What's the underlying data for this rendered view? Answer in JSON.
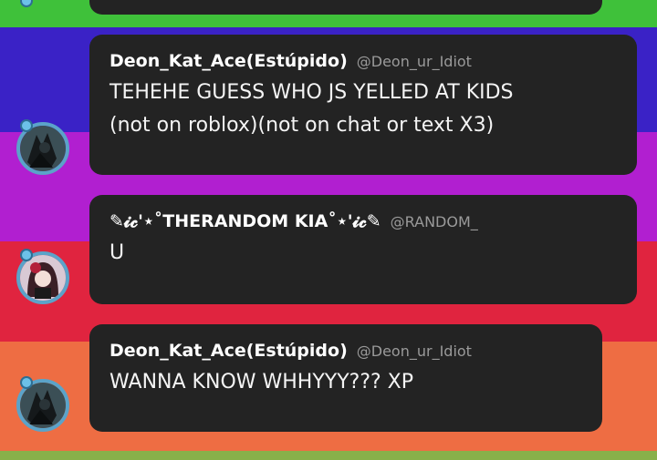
{
  "messages": [
    {
      "author": "Deon_Kat_Ace(Estúpido)",
      "handle": "@Deon_ur_Idiot",
      "lines": [
        "TEHEHE GUESS WHO JS YELLED AT KIDS",
        "(not on roblox)(not on chat or text X3)"
      ],
      "avatar_icon": "dark-character-avatar"
    },
    {
      "author": "✎𝓲𝓬'⋆˚THERANDOM KIA˚⋆'𝓲𝓬✎",
      "handle": "@RANDOM_",
      "lines": [
        "U"
      ],
      "avatar_icon": "anime-girl-avatar"
    },
    {
      "author": "Deon_Kat_Ace(Estúpido)",
      "handle": "@Deon_ur_Idiot",
      "lines": [
        "WANNA KNOW WHHYYY??? XP"
      ],
      "avatar_icon": "dark-character-avatar"
    }
  ],
  "colors": {
    "bubble": "#232323",
    "handle": "#9a9a9a",
    "bands": [
      "#3fc13a",
      "#3a22c6",
      "#b11fd0",
      "#e0243f",
      "#ee6d43"
    ]
  }
}
